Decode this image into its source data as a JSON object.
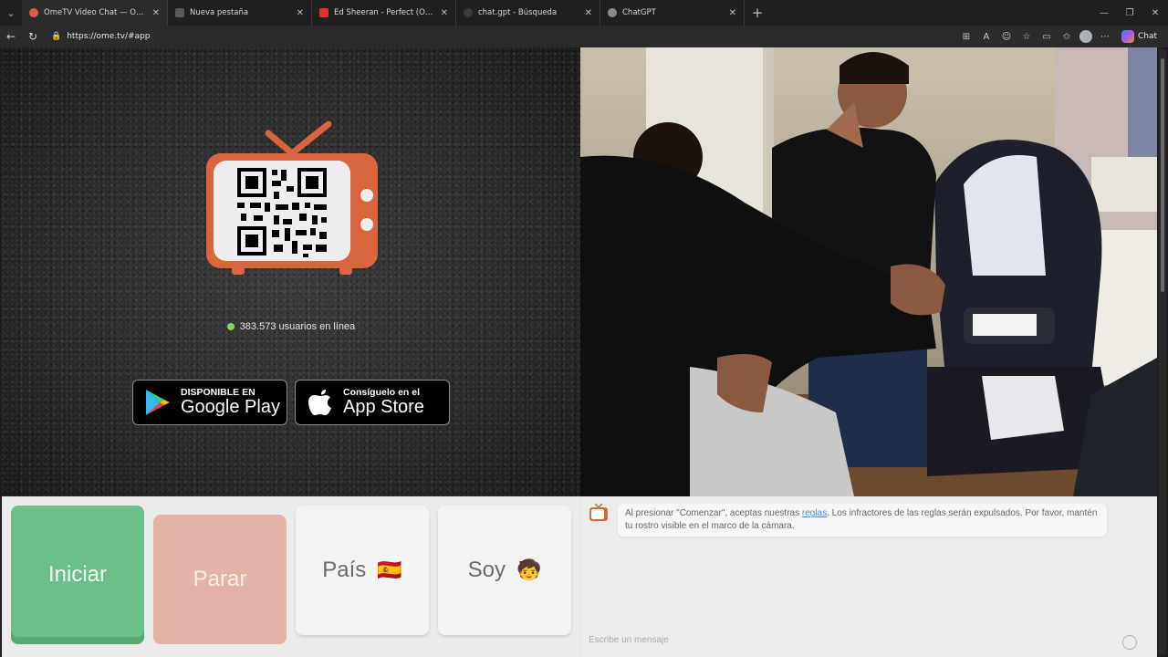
{
  "browser": {
    "tabs": [
      {
        "title": "OmeTV Video Chat — Omegl",
        "active": true,
        "favicon_color": "#e05a4e"
      },
      {
        "title": "Nueva pestaña",
        "active": false,
        "favicon_color": "#5a5a5a"
      },
      {
        "title": "Ed Sheeran - Perfect (Official Musi",
        "active": false,
        "favicon_color": "#e03030"
      },
      {
        "title": "chat.gpt - Búsqueda",
        "active": false,
        "favicon_color": "#3a3a3a"
      },
      {
        "title": "ChatGPT",
        "active": false,
        "favicon_color": "#8a8a8a"
      }
    ],
    "url": "https://ome.tv/#app",
    "copilot_label": "Chat"
  },
  "left": {
    "online_count": "383.573 usuarios en línea",
    "google_play": {
      "small": "DISPONIBLE EN",
      "big": "Google Play"
    },
    "app_store": {
      "small": "Consíguelo en el",
      "big": "App Store"
    }
  },
  "controls": {
    "start": "Iniciar",
    "stop": "Parar",
    "country": "País",
    "gender": "Soy",
    "country_flag": "🇪🇸",
    "gender_emoji": "🧒"
  },
  "chat": {
    "notice_before": "Al presionar \"Comenzar\", aceptas nuestras ",
    "notice_link": "reglas",
    "notice_after": ". Los infractores de las reglas serán expulsados. Por favor, mantén tu rostro visible en el marco de la cámara.",
    "placeholder": "Escribe un mensaje"
  },
  "colors": {
    "accent_green": "#6bbf8a",
    "stop_red": "#e3b3a8",
    "tv_orange": "#d9663e",
    "online_dot": "#7ed957"
  }
}
